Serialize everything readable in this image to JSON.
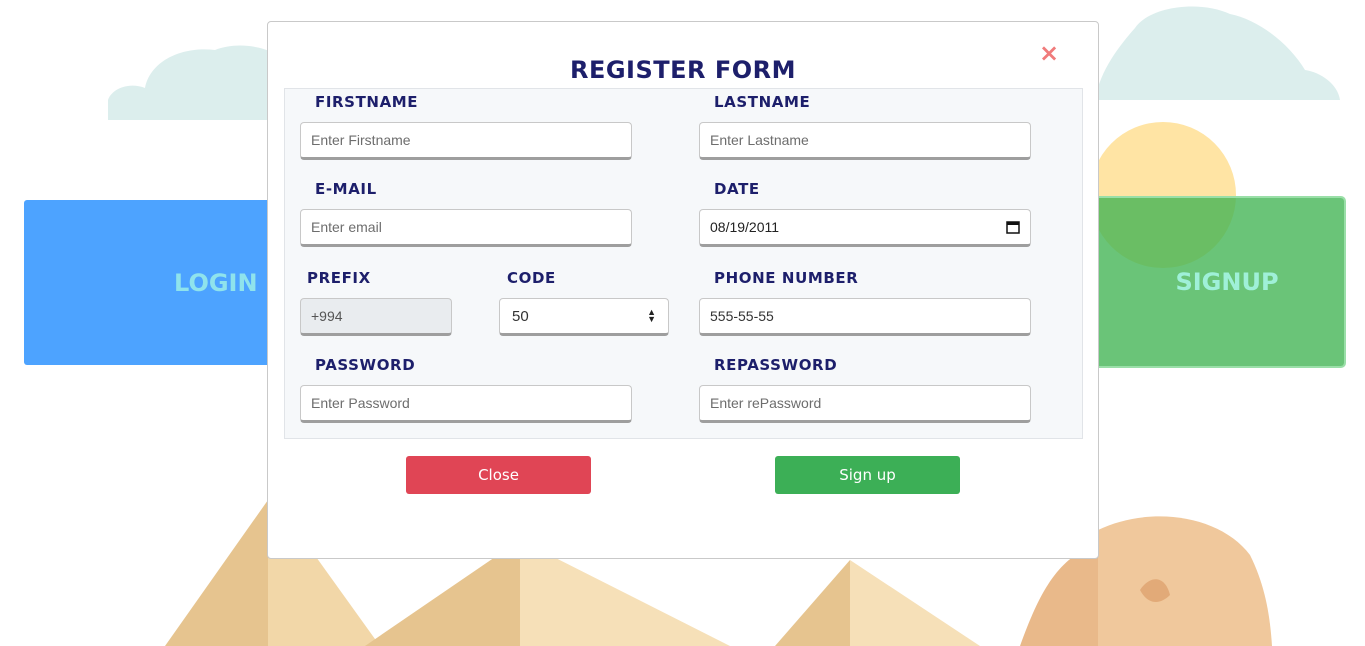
{
  "background": {
    "login_label": "LOGIN",
    "signup_label": "SIGNUP"
  },
  "modal": {
    "title": "REGISTER FORM",
    "close_icon": "×",
    "fields": {
      "firstname": {
        "label": "FIRSTNAME",
        "placeholder": "Enter Firstname",
        "value": ""
      },
      "lastname": {
        "label": "LASTNAME",
        "placeholder": "Enter Lastname",
        "value": ""
      },
      "email": {
        "label": "E-MAIL",
        "placeholder": "Enter email",
        "value": ""
      },
      "date": {
        "label": "DATE",
        "value": "08/19/2011"
      },
      "prefix": {
        "label": "PREFIX",
        "value": "+994"
      },
      "code": {
        "label": "CODE",
        "value": "50"
      },
      "phone": {
        "label": "PHONE NUMBER",
        "value": "555-55-55"
      },
      "password": {
        "label": "PASSWORD",
        "placeholder": "Enter Password",
        "value": ""
      },
      "repassword": {
        "label": "REPASSWORD",
        "placeholder": "Enter rePassword",
        "value": ""
      }
    },
    "buttons": {
      "close": "Close",
      "signup": "Sign up"
    }
  },
  "colors": {
    "title": "#1d1f6b",
    "close_button": "#e04555",
    "signup_button": "#3caf56",
    "close_icon": "#f07b7b"
  }
}
